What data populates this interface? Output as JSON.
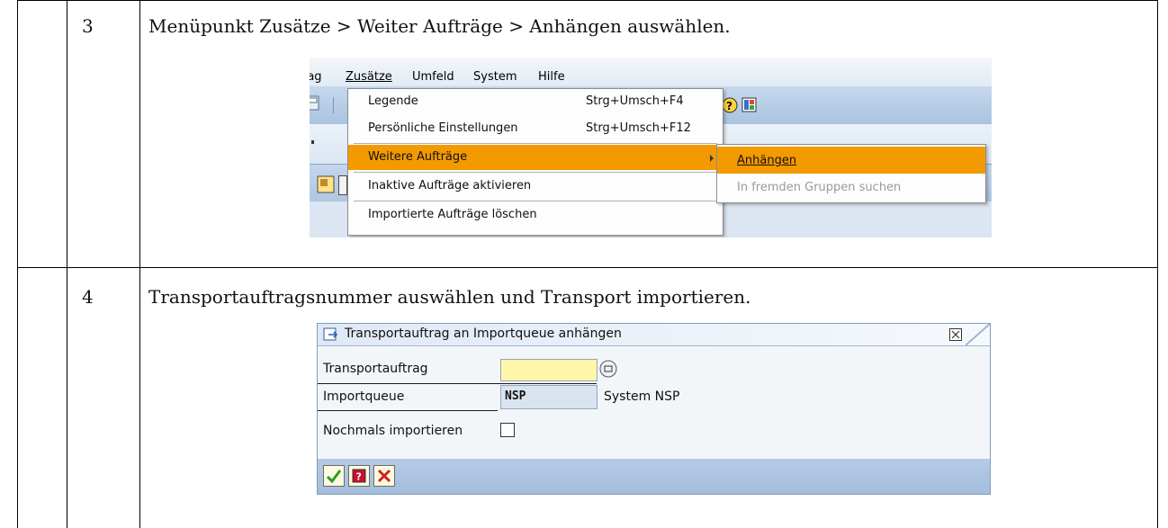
{
  "steps": [
    {
      "number": "3",
      "text": "Menüpunkt Zusätze > Weiter Aufträge > Anhängen auswählen."
    },
    {
      "number": "4",
      "text": "Transportauftragsnummer auswählen und Transport importieren."
    }
  ],
  "sap_menu": {
    "menubar": [
      "rag",
      "Zusätze",
      "Umfeld",
      "System",
      "Hilfe"
    ],
    "items": [
      {
        "label": "Legende",
        "shortcut": "Strg+Umsch+F4"
      },
      {
        "label": "Persönliche Einstellungen",
        "shortcut": "Strg+Umsch+F12"
      },
      {
        "label": "Weitere Aufträge",
        "shortcut": ""
      },
      {
        "label": "Inaktive Aufträge aktivieren",
        "shortcut": ""
      },
      {
        "label": "Importierte Aufträge löschen",
        "shortcut": ""
      }
    ],
    "submenu": [
      {
        "label": "Anhängen"
      },
      {
        "label": "In fremden Gruppen suchen"
      }
    ]
  },
  "dialog": {
    "title": "Transportauftrag an Importqueue anhängen",
    "transport_label": "Transportauftrag",
    "transport_value": "",
    "queue_label": "Importqueue",
    "queue_value": "NSP",
    "queue_system": "System NSP",
    "reimport_label": "Nochmals importieren"
  },
  "colors": {
    "highlight": "#f39a00",
    "required_field": "#fff6a8",
    "sap_blue": "#a9c3e1"
  }
}
